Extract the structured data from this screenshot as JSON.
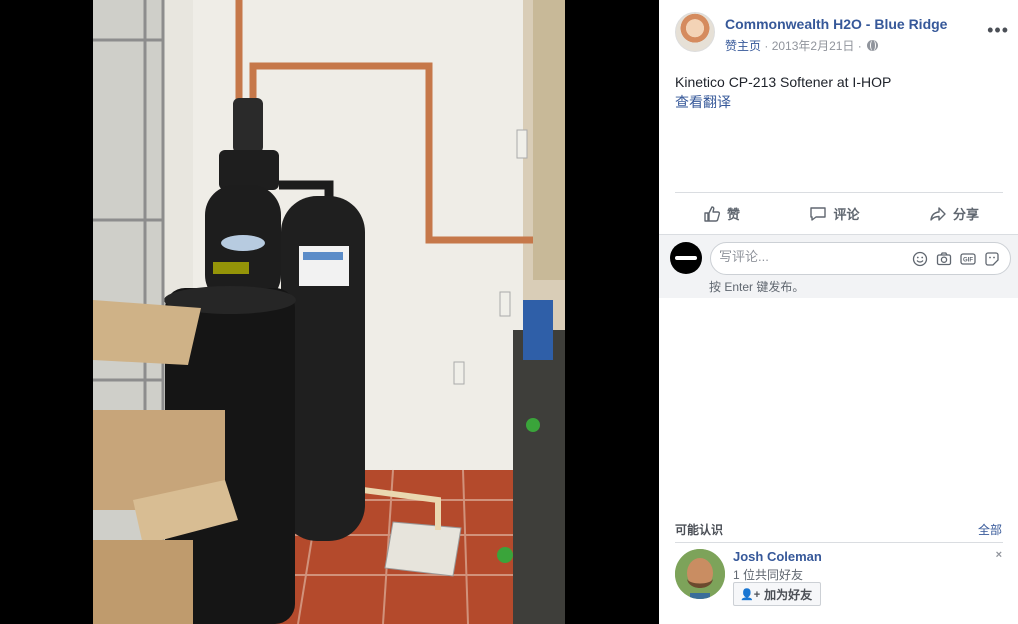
{
  "post": {
    "page_name": "Commonwealth H2O - Blue Ridge",
    "like_page": "赞主页",
    "separator": "·",
    "date": "2013年2月21日",
    "separator2": "·",
    "text": "Kinetico CP-213 Softener at I-HOP",
    "translate": "查看翻译",
    "more_icon": "more-icon"
  },
  "actions": {
    "like": "赞",
    "comment": "评论",
    "share": "分享"
  },
  "comment": {
    "placeholder": "写评论...",
    "hint": "按 Enter 键发布。",
    "icons": [
      "emoji-icon",
      "camera-icon",
      "gif-icon",
      "sticker-icon"
    ]
  },
  "pymk": {
    "title": "可能认识",
    "see_all": "全部",
    "friend": {
      "name": "Josh Coleman",
      "mutual": "1 位共同好友",
      "add_button": "加为好友",
      "close": "×"
    }
  },
  "colors": {
    "link": "#365899",
    "panel_bg": "#ffffff",
    "comment_bg": "#f2f3f5",
    "viewer_bg": "#000000"
  }
}
